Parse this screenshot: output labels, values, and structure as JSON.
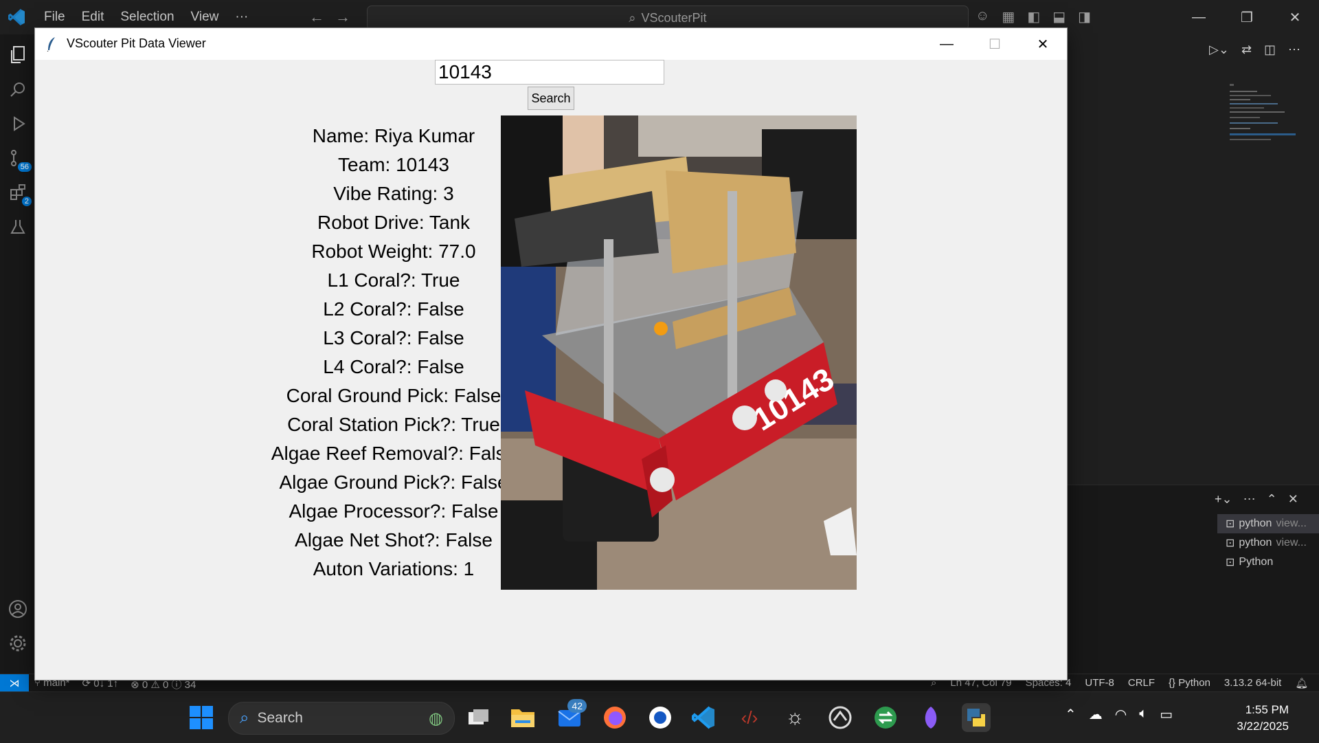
{
  "vscode": {
    "menu": [
      "File",
      "Edit",
      "Selection",
      "View",
      "···"
    ],
    "command_center": "VScouterPit",
    "activity_badges": {
      "source_control": "56",
      "extensions": "2"
    },
    "terminals": [
      {
        "name": "python",
        "detail": "view..."
      },
      {
        "name": "python",
        "detail": "view..."
      },
      {
        "name": "Python",
        "detail": ""
      }
    ],
    "status": {
      "branch": "main*",
      "sync": "0↓ 1↑",
      "problems": "⊗ 0 ⚠ 0 ⓘ 34",
      "position": "Ln 47, Col 79",
      "spaces": "Spaces: 4",
      "encoding": "UTF-8",
      "eol": "CRLF",
      "language": "Python",
      "interpreter": "3.13.2 64-bit"
    }
  },
  "app": {
    "title": "VScouter Pit Data Viewer",
    "search_value": "10143",
    "search_button": "Search",
    "fields": [
      "Name: Riya Kumar",
      "Team: 10143",
      "Vibe Rating: 3",
      "Robot Drive: Tank",
      "Robot Weight: 77.0",
      "L1 Coral?: True",
      "L2 Coral?: False",
      "L3 Coral?: False",
      "L4 Coral?: False",
      "Coral Ground Pick: False",
      "Coral Station Pick?: True",
      "Algae Reef Removal?: False",
      "Algae Ground Pick?: False",
      "Algae Processor?: False",
      "Algae Net Shot?: False",
      "Auton Variations: 1"
    ],
    "robot_bumper_text": "10143"
  },
  "taskbar": {
    "search_label": "Search",
    "mail_badge": "42",
    "time": "1:55 PM",
    "date": "3/22/2025"
  },
  "colors": {
    "vscode_blue": "#0078d4",
    "bumper_red": "#d0202a"
  }
}
